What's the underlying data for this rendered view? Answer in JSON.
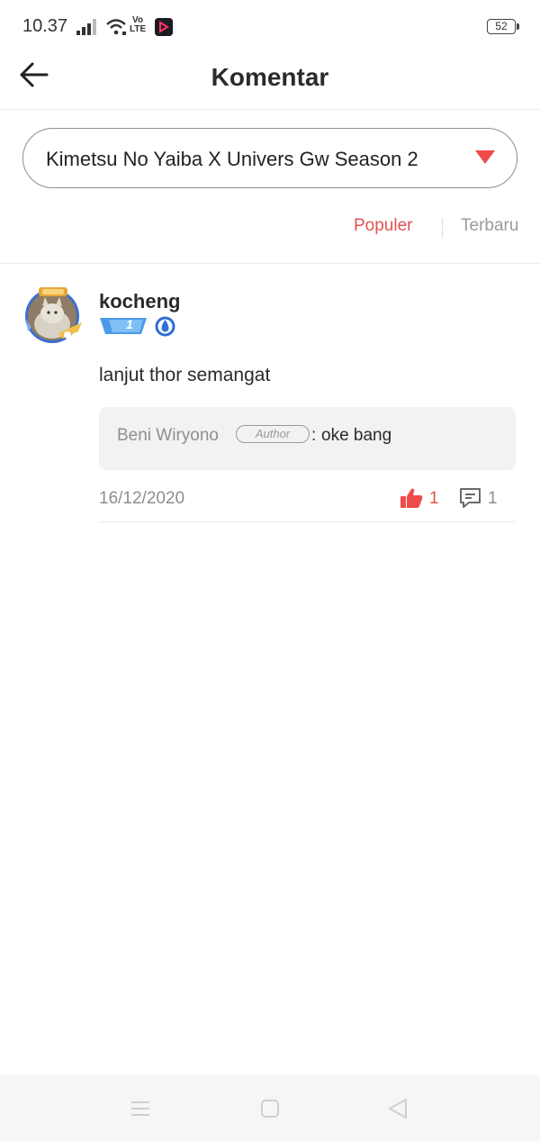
{
  "status_bar": {
    "time": "10.37",
    "volte_top": "Vo",
    "volte_bottom": "LTE",
    "battery": "52",
    "icons": [
      "signal-icon",
      "wifi-icon",
      "volte-icon",
      "app-notification-icon",
      "battery-icon"
    ]
  },
  "header": {
    "title": "Komentar",
    "back_icon": "arrow-left-icon"
  },
  "dropdown": {
    "selected": "Kimetsu No Yaiba X Univers Gw Season 2",
    "arrow_color": "#ef4b4b"
  },
  "sort_tabs": {
    "active": "Populer",
    "inactive": "Terbaru",
    "active_color": "#e25252"
  },
  "comments": [
    {
      "username": "kocheng",
      "level": "1",
      "text": "lanjut thor semangat",
      "reply": {
        "author": "Beni Wiryono",
        "badge": "Author",
        "separator": ":",
        "text": "oke bang"
      },
      "date": "16/12/2020",
      "likes": "1",
      "replies": "1"
    }
  ],
  "nav_bar": {
    "icons": [
      "menu-icon",
      "home-square-icon",
      "back-triangle-icon"
    ]
  }
}
